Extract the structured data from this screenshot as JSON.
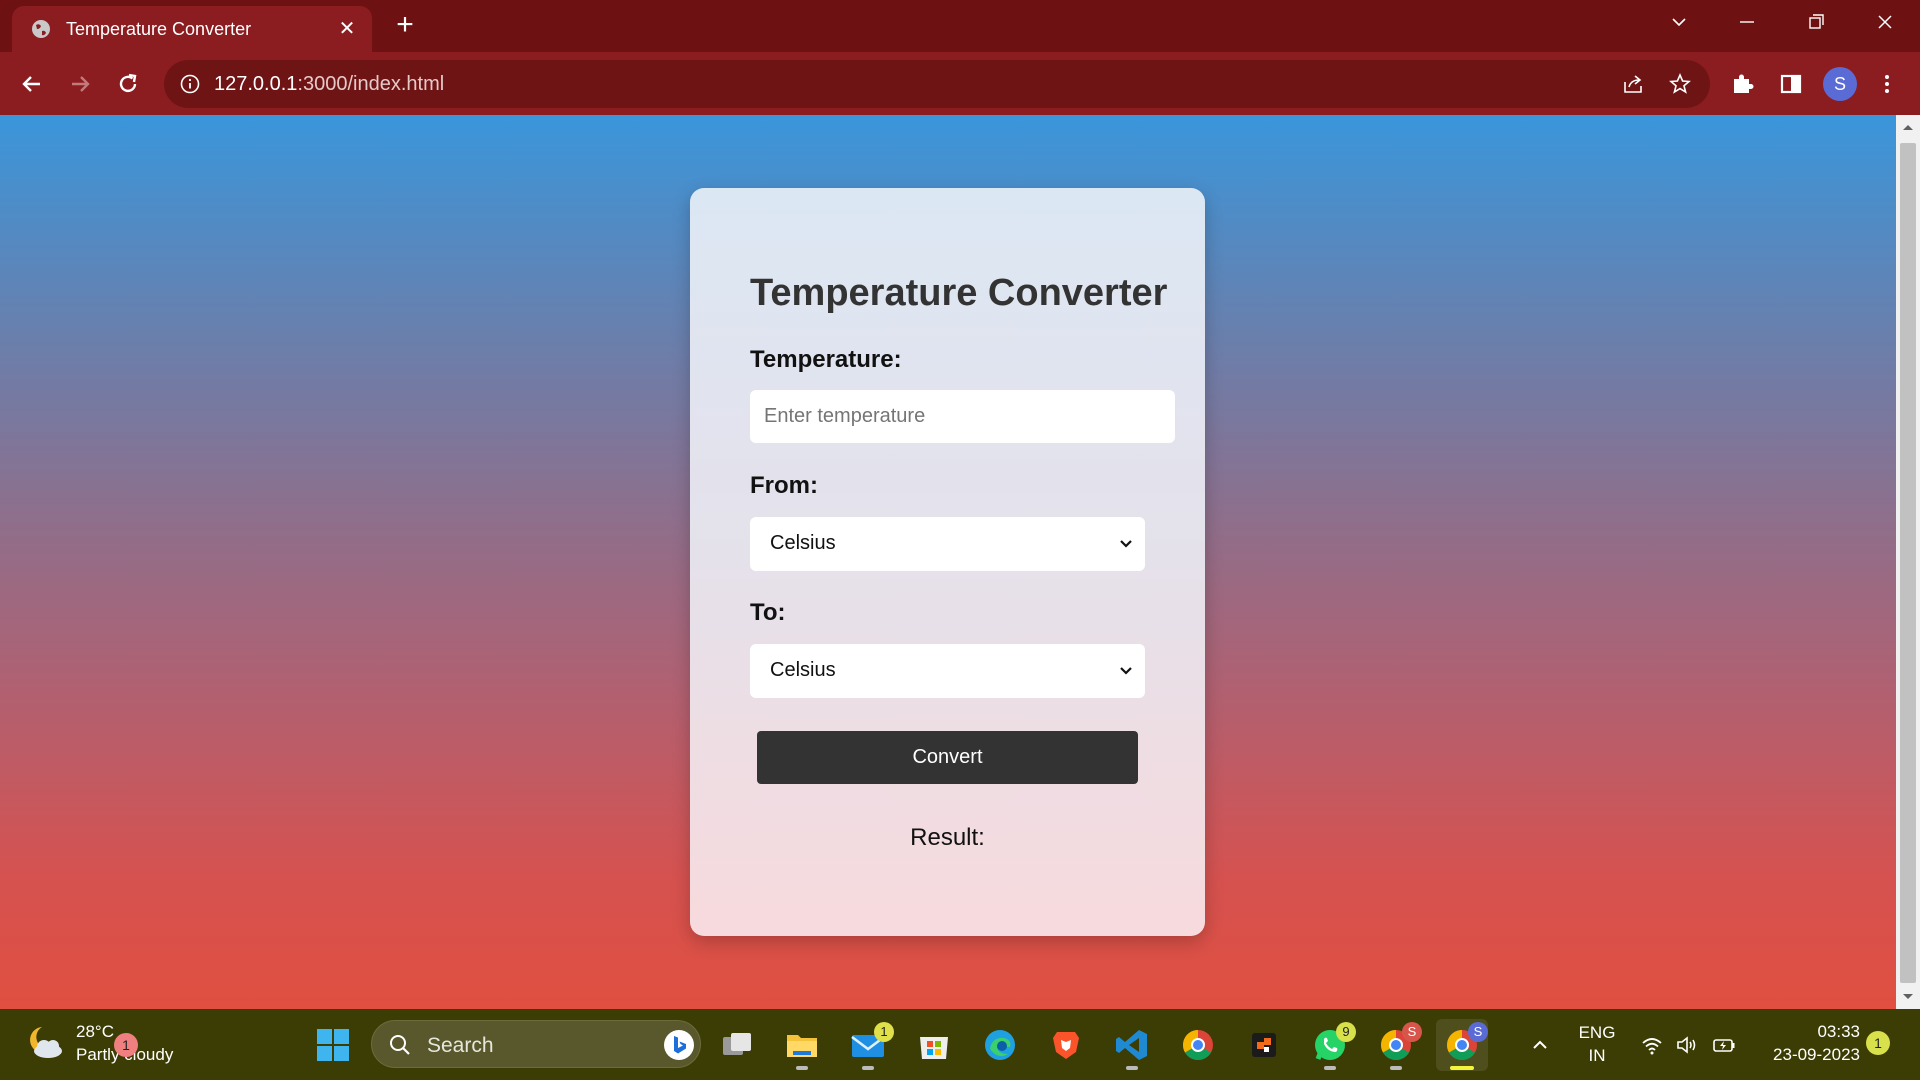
{
  "browser": {
    "tab_title": "Temperature Converter",
    "url_host": "127.0.0.1",
    "url_rest": ":3000/index.html",
    "profile_initial": "S"
  },
  "page": {
    "title": "Temperature Converter",
    "temperature_label": "Temperature:",
    "temperature_placeholder": "Enter temperature",
    "temperature_value": "",
    "from_label": "From:",
    "from_value": "Celsius",
    "to_label": "To:",
    "to_value": "Celsius",
    "convert_label": "Convert",
    "result_label": "Result:"
  },
  "taskbar": {
    "weather_temp": "28°C",
    "weather_desc": "Partly cloudy",
    "weather_badge": "1",
    "search_label": "Search",
    "mail_badge": "1",
    "whatsapp_badge": "9",
    "chrome_profile_s_badge": "S",
    "chrome_active_badge": "S",
    "language": "ENG",
    "region": "IN",
    "time": "03:33",
    "date": "23-09-2023",
    "notification_count": "1"
  },
  "colors": {
    "tab_bar": "#6e1112",
    "toolbar": "#8b1c1f",
    "convert_button": "#333333",
    "taskbar": "#3c3c05"
  }
}
